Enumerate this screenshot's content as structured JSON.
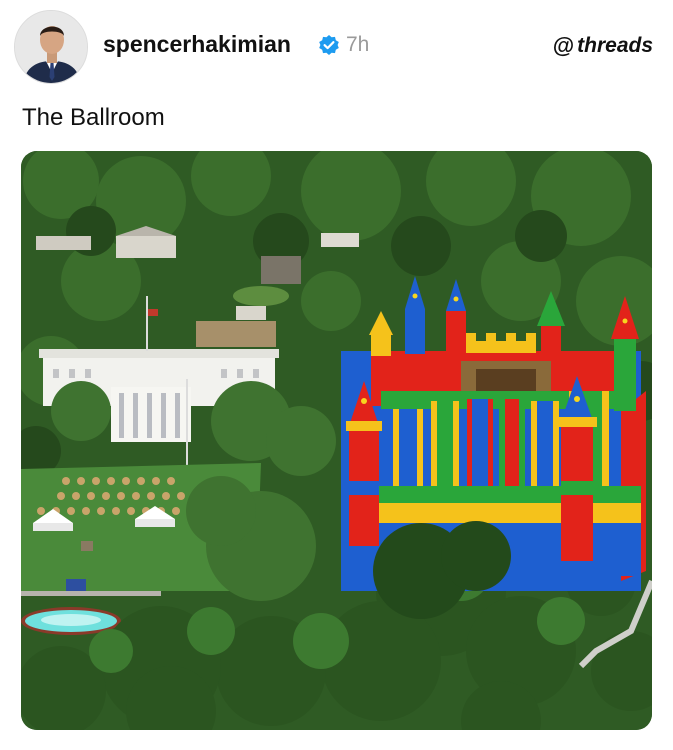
{
  "post": {
    "username": "spencerhakimian",
    "time": "7h",
    "caption": "The Ballroom",
    "verified_color": "#1d9bf0"
  },
  "brand": {
    "label": "threads",
    "icon": "threads-logo-icon"
  },
  "image": {
    "icon": "photo-image",
    "colors": {
      "trees": "#2f5b24",
      "lawn": "#4a8a3a",
      "building": "#f2f2ee",
      "castle_red": "#e2231a",
      "castle_blue": "#1e5fd0",
      "castle_yellow": "#f5c21b",
      "castle_green": "#2aa63a"
    }
  }
}
